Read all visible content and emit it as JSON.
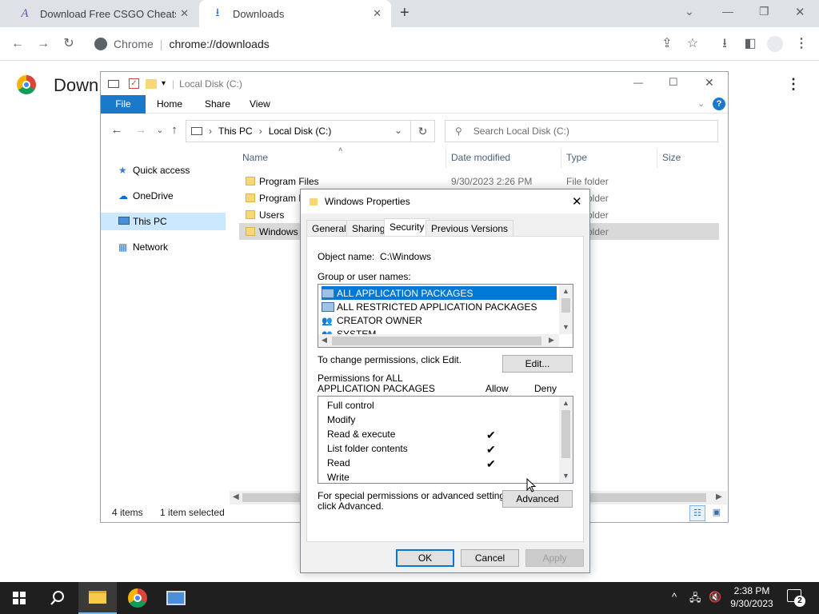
{
  "chrome": {
    "tabs": [
      {
        "title": "Download Free CSGO Cheats - A",
        "icon": "app-logo-icon"
      },
      {
        "title": "Downloads",
        "icon": "download-icon"
      }
    ],
    "new_tab": "+",
    "address_prefix": "Chrome",
    "address_url": "chrome://downloads"
  },
  "downloads_page": {
    "title": "Down"
  },
  "explorer": {
    "title": "Local Disk (C:)",
    "ribbon_tabs": [
      "File",
      "Home",
      "Share",
      "View"
    ],
    "breadcrumb": [
      "This PC",
      "Local Disk (C:)"
    ],
    "search_placeholder": "Search Local Disk (C:)",
    "nav_items": [
      "Quick access",
      "OneDrive",
      "This PC",
      "Network"
    ],
    "columns": [
      "Name",
      "Date modified",
      "Type",
      "Size"
    ],
    "files": [
      {
        "name": "Program Files",
        "date": "9/30/2023 2:26 PM",
        "type": "File folder"
      },
      {
        "name": "Program Files (x86)",
        "date": "",
        "type": "File folder"
      },
      {
        "name": "Users",
        "date": "",
        "type": "File folder"
      },
      {
        "name": "Windows",
        "date": "",
        "type": "File folder"
      }
    ],
    "status_items": "4 items",
    "status_selected": "1 item selected"
  },
  "dialog": {
    "title": "Windows Properties",
    "tabs": [
      "General",
      "Sharing",
      "Security",
      "Previous Versions"
    ],
    "object_name_label": "Object name:",
    "object_name_value": "C:\\Windows",
    "group_label": "Group or user names:",
    "users": [
      "ALL APPLICATION PACKAGES",
      "ALL RESTRICTED APPLICATION PACKAGES",
      "CREATOR OWNER",
      "SYSTEM"
    ],
    "change_text": "To change permissions, click Edit.",
    "edit_button": "Edit...",
    "perm_header_1": "Permissions for ALL",
    "perm_header_2": "APPLICATION PACKAGES",
    "allow_label": "Allow",
    "deny_label": "Deny",
    "permissions": [
      {
        "name": "Full control",
        "allow": ""
      },
      {
        "name": "Modify",
        "allow": ""
      },
      {
        "name": "Read & execute",
        "allow": "✔"
      },
      {
        "name": "List folder contents",
        "allow": "✔"
      },
      {
        "name": "Read",
        "allow": "✔"
      },
      {
        "name": "Write",
        "allow": ""
      }
    ],
    "advanced_text_1": "For special permissions or advanced settings,",
    "advanced_text_2": "click Advanced.",
    "advanced_button": "Advanced",
    "ok_button": "OK",
    "cancel_button": "Cancel",
    "apply_button": "Apply"
  },
  "taskbar": {
    "time": "2:38 PM",
    "date": "9/30/2023",
    "notification_count": "2"
  }
}
